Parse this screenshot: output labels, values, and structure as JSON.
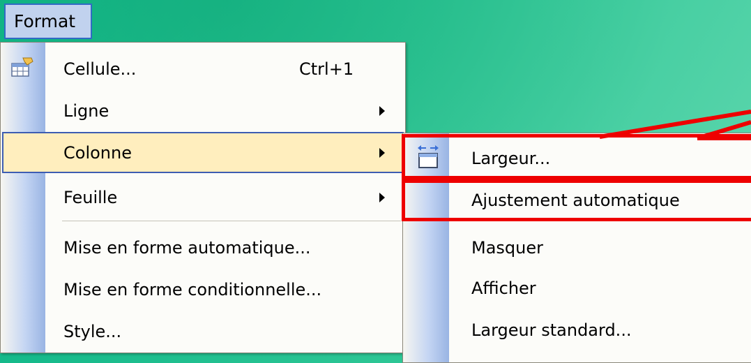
{
  "menubar": {
    "format_label": "Format"
  },
  "main_menu": {
    "items": [
      {
        "label": "Cellule...",
        "shortcut": "Ctrl+1"
      },
      {
        "label": "Ligne"
      },
      {
        "label": "Colonne"
      },
      {
        "label": "Feuille"
      },
      {
        "label": "Mise en forme automatique..."
      },
      {
        "label": "Mise en forme conditionnelle..."
      },
      {
        "label": "Style..."
      }
    ]
  },
  "sub_menu": {
    "items": [
      {
        "label": "Largeur..."
      },
      {
        "label": "Ajustement automatique"
      },
      {
        "label": "Masquer"
      },
      {
        "label": "Afficher"
      },
      {
        "label": "Largeur standard..."
      }
    ]
  },
  "icons": {
    "cellule": "format-cells-icon",
    "largeur": "column-width-icon",
    "submenu_arrow": "submenu-arrow-icon"
  },
  "colors": {
    "background": "#2fc796",
    "highlight": "#ffeebe",
    "highlight_border": "#3d5db2",
    "annotation": "#ee0000"
  }
}
